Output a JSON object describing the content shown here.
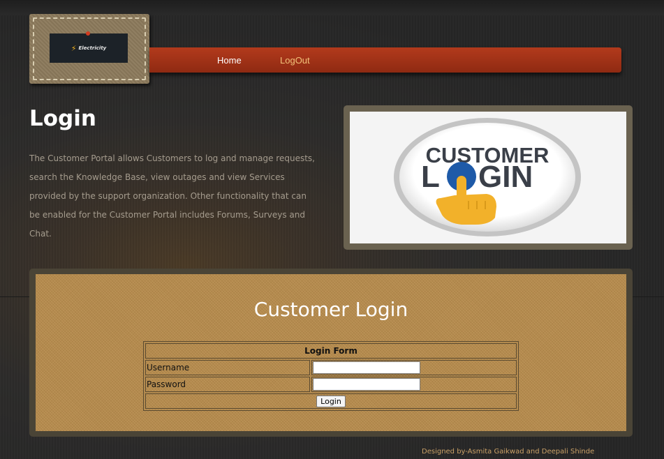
{
  "logo": {
    "brand_text": "Electricity",
    "icon": "lightning-bolt-icon"
  },
  "nav": {
    "home": "Home",
    "logout": "LogOut"
  },
  "intro": {
    "heading": "Login",
    "paragraph": "The Customer Portal allows Customers to log and manage requests, search the Knowledge Base, view outages and view Services provided by the support organization. Other functionality that can be enabled for the Customer Portal includes Forums, Surveys and Chat."
  },
  "banner_image": {
    "line1": "CUSTOMER",
    "line2_start": "L",
    "line2_end": "GIN"
  },
  "form": {
    "title": "Customer Login",
    "table_heading": "Login Form",
    "username_label": "Username",
    "password_label": "Password",
    "username_value": "",
    "password_value": "",
    "submit_label": "Login"
  },
  "footer": {
    "credit": "Designed by-Asmita Gaikwad and Deepali Shinde"
  },
  "colors": {
    "nav_red": "#a8341a",
    "panel_tan": "#b88c4c",
    "footer_text": "#c9a066",
    "logout_link": "#f2c27a"
  }
}
